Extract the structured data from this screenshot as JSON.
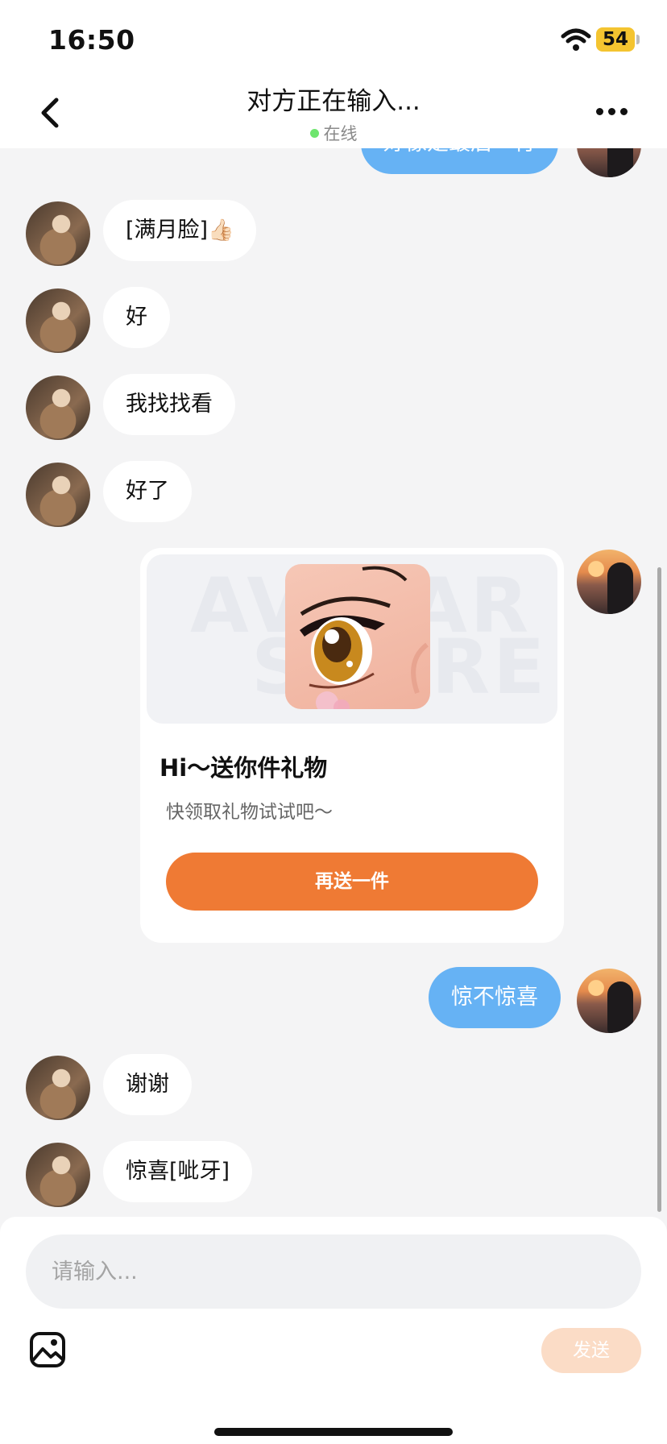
{
  "status_bar": {
    "time": "16:50",
    "battery": "54"
  },
  "header": {
    "title": "对方正在输入...",
    "status": "在线"
  },
  "messages": [
    {
      "side": "out",
      "text": "好像是最后一行"
    },
    {
      "side": "in",
      "text": "[满月脸]",
      "emoji": "👍🏻"
    },
    {
      "side": "in",
      "text": "好"
    },
    {
      "side": "in",
      "text": "我找找看"
    },
    {
      "side": "in",
      "text": "好了"
    },
    {
      "side": "out",
      "text": "惊不惊喜"
    },
    {
      "side": "in",
      "text": "谢谢"
    },
    {
      "side": "in",
      "text": "惊喜[呲牙]"
    }
  ],
  "gift_card": {
    "watermark_line1": "AVATAR",
    "watermark_line2": "STORE",
    "title": "Hi～送你件礼物",
    "subtitle": "快领取礼物试试吧～",
    "button": "再送一件"
  },
  "composer": {
    "placeholder": "请输入...",
    "send_label": "发送"
  },
  "colors": {
    "accent": "#ef7a34",
    "outgoing_bubble": "#66b2f4",
    "online_dot": "#6ee56e"
  },
  "icons": {
    "back": "chevron-left-icon",
    "more": "more-dots-icon",
    "image": "image-icon",
    "wifi": "wifi-icon"
  }
}
